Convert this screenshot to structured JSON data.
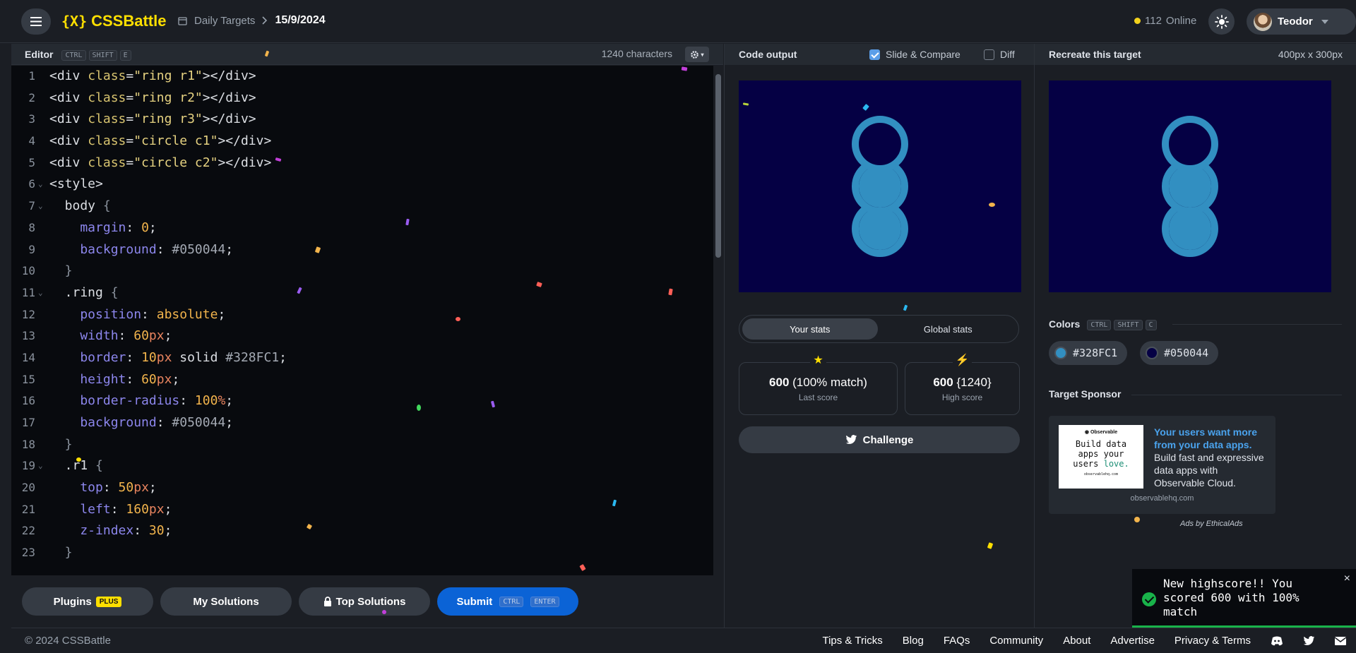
{
  "header": {
    "app_name": "CSSBattle",
    "logo_mark": "{X}",
    "breadcrumb_section": "Daily Targets",
    "breadcrumb_current": "15/9/2024",
    "online_count": "112",
    "online_label": "Online",
    "user_name": "Teodor"
  },
  "editor": {
    "title": "Editor",
    "shortcut": [
      "CTRL",
      "SHIFT",
      "E"
    ],
    "char_count": "1240 characters",
    "lines": [
      {
        "n": "1",
        "fold": "",
        "tokens": [
          [
            "tag",
            "<div "
          ],
          [
            "attr",
            "class"
          ],
          [
            "plain",
            "="
          ],
          [
            "str",
            "\"ring r1\""
          ],
          [
            "tag",
            "></div>"
          ]
        ]
      },
      {
        "n": "2",
        "fold": "",
        "tokens": [
          [
            "tag",
            "<div "
          ],
          [
            "attr",
            "class"
          ],
          [
            "plain",
            "="
          ],
          [
            "str",
            "\"ring r2\""
          ],
          [
            "tag",
            "></div>"
          ]
        ]
      },
      {
        "n": "3",
        "fold": "",
        "tokens": [
          [
            "tag",
            "<div "
          ],
          [
            "attr",
            "class"
          ],
          [
            "plain",
            "="
          ],
          [
            "str",
            "\"ring r3\""
          ],
          [
            "tag",
            "></div>"
          ]
        ]
      },
      {
        "n": "4",
        "fold": "",
        "tokens": [
          [
            "tag",
            "<div "
          ],
          [
            "attr",
            "class"
          ],
          [
            "plain",
            "="
          ],
          [
            "str",
            "\"circle c1\""
          ],
          [
            "tag",
            "></div>"
          ]
        ]
      },
      {
        "n": "5",
        "fold": "",
        "tokens": [
          [
            "tag",
            "<div "
          ],
          [
            "attr",
            "class"
          ],
          [
            "plain",
            "="
          ],
          [
            "str",
            "\"circle c2\""
          ],
          [
            "tag",
            "></div>"
          ]
        ]
      },
      {
        "n": "6",
        "fold": "⌄",
        "tokens": [
          [
            "tag",
            "<style>"
          ]
        ]
      },
      {
        "n": "7",
        "fold": "⌄",
        "tokens": [
          [
            "sel",
            "  body "
          ],
          [
            "brace",
            "{"
          ]
        ]
      },
      {
        "n": "8",
        "fold": "",
        "tokens": [
          [
            "prop",
            "    margin"
          ],
          [
            "plain",
            ": "
          ],
          [
            "num",
            "0"
          ],
          [
            "plain",
            ";"
          ]
        ]
      },
      {
        "n": "9",
        "fold": "",
        "tokens": [
          [
            "prop",
            "    background"
          ],
          [
            "plain",
            ": "
          ],
          [
            "hex",
            "#050044"
          ],
          [
            "plain",
            ";"
          ]
        ]
      },
      {
        "n": "10",
        "fold": "",
        "tokens": [
          [
            "brace",
            "  }"
          ]
        ]
      },
      {
        "n": "11",
        "fold": "⌄",
        "tokens": [
          [
            "sel",
            "  .ring "
          ],
          [
            "brace",
            "{"
          ]
        ]
      },
      {
        "n": "12",
        "fold": "",
        "tokens": [
          [
            "prop",
            "    position"
          ],
          [
            "plain",
            ": "
          ],
          [
            "kw",
            "absolute"
          ],
          [
            "plain",
            ";"
          ]
        ]
      },
      {
        "n": "13",
        "fold": "",
        "tokens": [
          [
            "prop",
            "    width"
          ],
          [
            "plain",
            ": "
          ],
          [
            "num",
            "60"
          ],
          [
            "unit",
            "px"
          ],
          [
            "plain",
            ";"
          ]
        ]
      },
      {
        "n": "14",
        "fold": "",
        "tokens": [
          [
            "prop",
            "    border"
          ],
          [
            "plain",
            ": "
          ],
          [
            "num",
            "10"
          ],
          [
            "unit",
            "px"
          ],
          [
            "plain",
            " solid "
          ],
          [
            "hex",
            "#328FC1"
          ],
          [
            "plain",
            ";"
          ]
        ]
      },
      {
        "n": "15",
        "fold": "",
        "tokens": [
          [
            "prop",
            "    height"
          ],
          [
            "plain",
            ": "
          ],
          [
            "num",
            "60"
          ],
          [
            "unit",
            "px"
          ],
          [
            "plain",
            ";"
          ]
        ]
      },
      {
        "n": "16",
        "fold": "",
        "tokens": [
          [
            "prop",
            "    border-radius"
          ],
          [
            "plain",
            ": "
          ],
          [
            "num",
            "100"
          ],
          [
            "unit",
            "%"
          ],
          [
            "plain",
            ";"
          ]
        ]
      },
      {
        "n": "17",
        "fold": "",
        "tokens": [
          [
            "prop",
            "    background"
          ],
          [
            "plain",
            ": "
          ],
          [
            "hex",
            "#050044"
          ],
          [
            "plain",
            ";"
          ]
        ]
      },
      {
        "n": "18",
        "fold": "",
        "tokens": [
          [
            "brace",
            "  }"
          ]
        ]
      },
      {
        "n": "19",
        "fold": "⌄",
        "tokens": [
          [
            "sel",
            "  .r1 "
          ],
          [
            "brace",
            "{"
          ]
        ]
      },
      {
        "n": "20",
        "fold": "",
        "tokens": [
          [
            "prop",
            "    top"
          ],
          [
            "plain",
            ": "
          ],
          [
            "num",
            "50"
          ],
          [
            "unit",
            "px"
          ],
          [
            "plain",
            ";"
          ]
        ]
      },
      {
        "n": "21",
        "fold": "",
        "tokens": [
          [
            "prop",
            "    left"
          ],
          [
            "plain",
            ": "
          ],
          [
            "num",
            "160"
          ],
          [
            "unit",
            "px"
          ],
          [
            "plain",
            ";"
          ]
        ]
      },
      {
        "n": "22",
        "fold": "",
        "tokens": [
          [
            "prop",
            "    z-index"
          ],
          [
            "plain",
            ": "
          ],
          [
            "num",
            "30"
          ],
          [
            "plain",
            ";"
          ]
        ]
      },
      {
        "n": "23",
        "fold": "",
        "tokens": [
          [
            "brace",
            "  }"
          ]
        ]
      }
    ]
  },
  "bottom_bar": {
    "plugins_label": "Plugins",
    "plus_badge": "PLUS",
    "my_solutions_label": "My Solutions",
    "top_solutions_label": "Top Solutions",
    "submit_label": "Submit",
    "submit_shortcut": [
      "CTRL",
      "ENTER"
    ]
  },
  "output": {
    "title": "Code output",
    "slide_compare_label": "Slide & Compare",
    "slide_compare_checked": true,
    "diff_label": "Diff",
    "diff_checked": false,
    "tab_your_stats": "Your stats",
    "tab_global_stats": "Global stats",
    "last_score_value": "600",
    "last_score_detail": "(100% match)",
    "last_score_label": "Last score",
    "high_score_value": "600",
    "high_score_detail": "{1240}",
    "high_score_label": "High score",
    "challenge_label": "Challenge"
  },
  "target": {
    "title": "Recreate this target",
    "dimensions": "400px x 300px",
    "colors_title": "Colors",
    "colors_shortcut": [
      "CTRL",
      "SHIFT",
      "C"
    ],
    "colors": [
      {
        "hex": "#328FC1"
      },
      {
        "hex": "#050044"
      }
    ],
    "sponsor_title": "Target Sponsor",
    "ad_logo": "Observable",
    "ad_image_line1": "Build data",
    "ad_image_line2": "apps your",
    "ad_image_line3": "users",
    "ad_image_love": "love.",
    "ad_image_url": "observablehq.com",
    "ad_headline": "Your users want more from your data apps.",
    "ad_body": "Build fast and expressive data apps with Observable Cloud.",
    "ad_domain": "observablehq.com",
    "ads_by": "Ads by EthicalAds"
  },
  "toast": {
    "message": "New highscore!! You scored 600 with 100% match",
    "close": "×"
  },
  "footer": {
    "copyright": "© 2024 CSSBattle",
    "links": [
      "Tips & Tricks",
      "Blog",
      "FAQs",
      "Community",
      "About",
      "Advertise",
      "Privacy & Terms"
    ]
  },
  "colors": {
    "accent": "#ffdf00",
    "submit": "#0b63d6",
    "ring": "#328FC1",
    "bg_target": "#050044",
    "toast_bar": "#19b34a"
  },
  "icons": [
    "menu-icon",
    "calendar-icon",
    "chevron-right-icon",
    "sun-icon",
    "caret-down-icon",
    "gear-icon",
    "lock-icon",
    "twitter-icon",
    "star-icon",
    "bolt-icon",
    "check-icon",
    "discord-icon",
    "mail-icon"
  ]
}
